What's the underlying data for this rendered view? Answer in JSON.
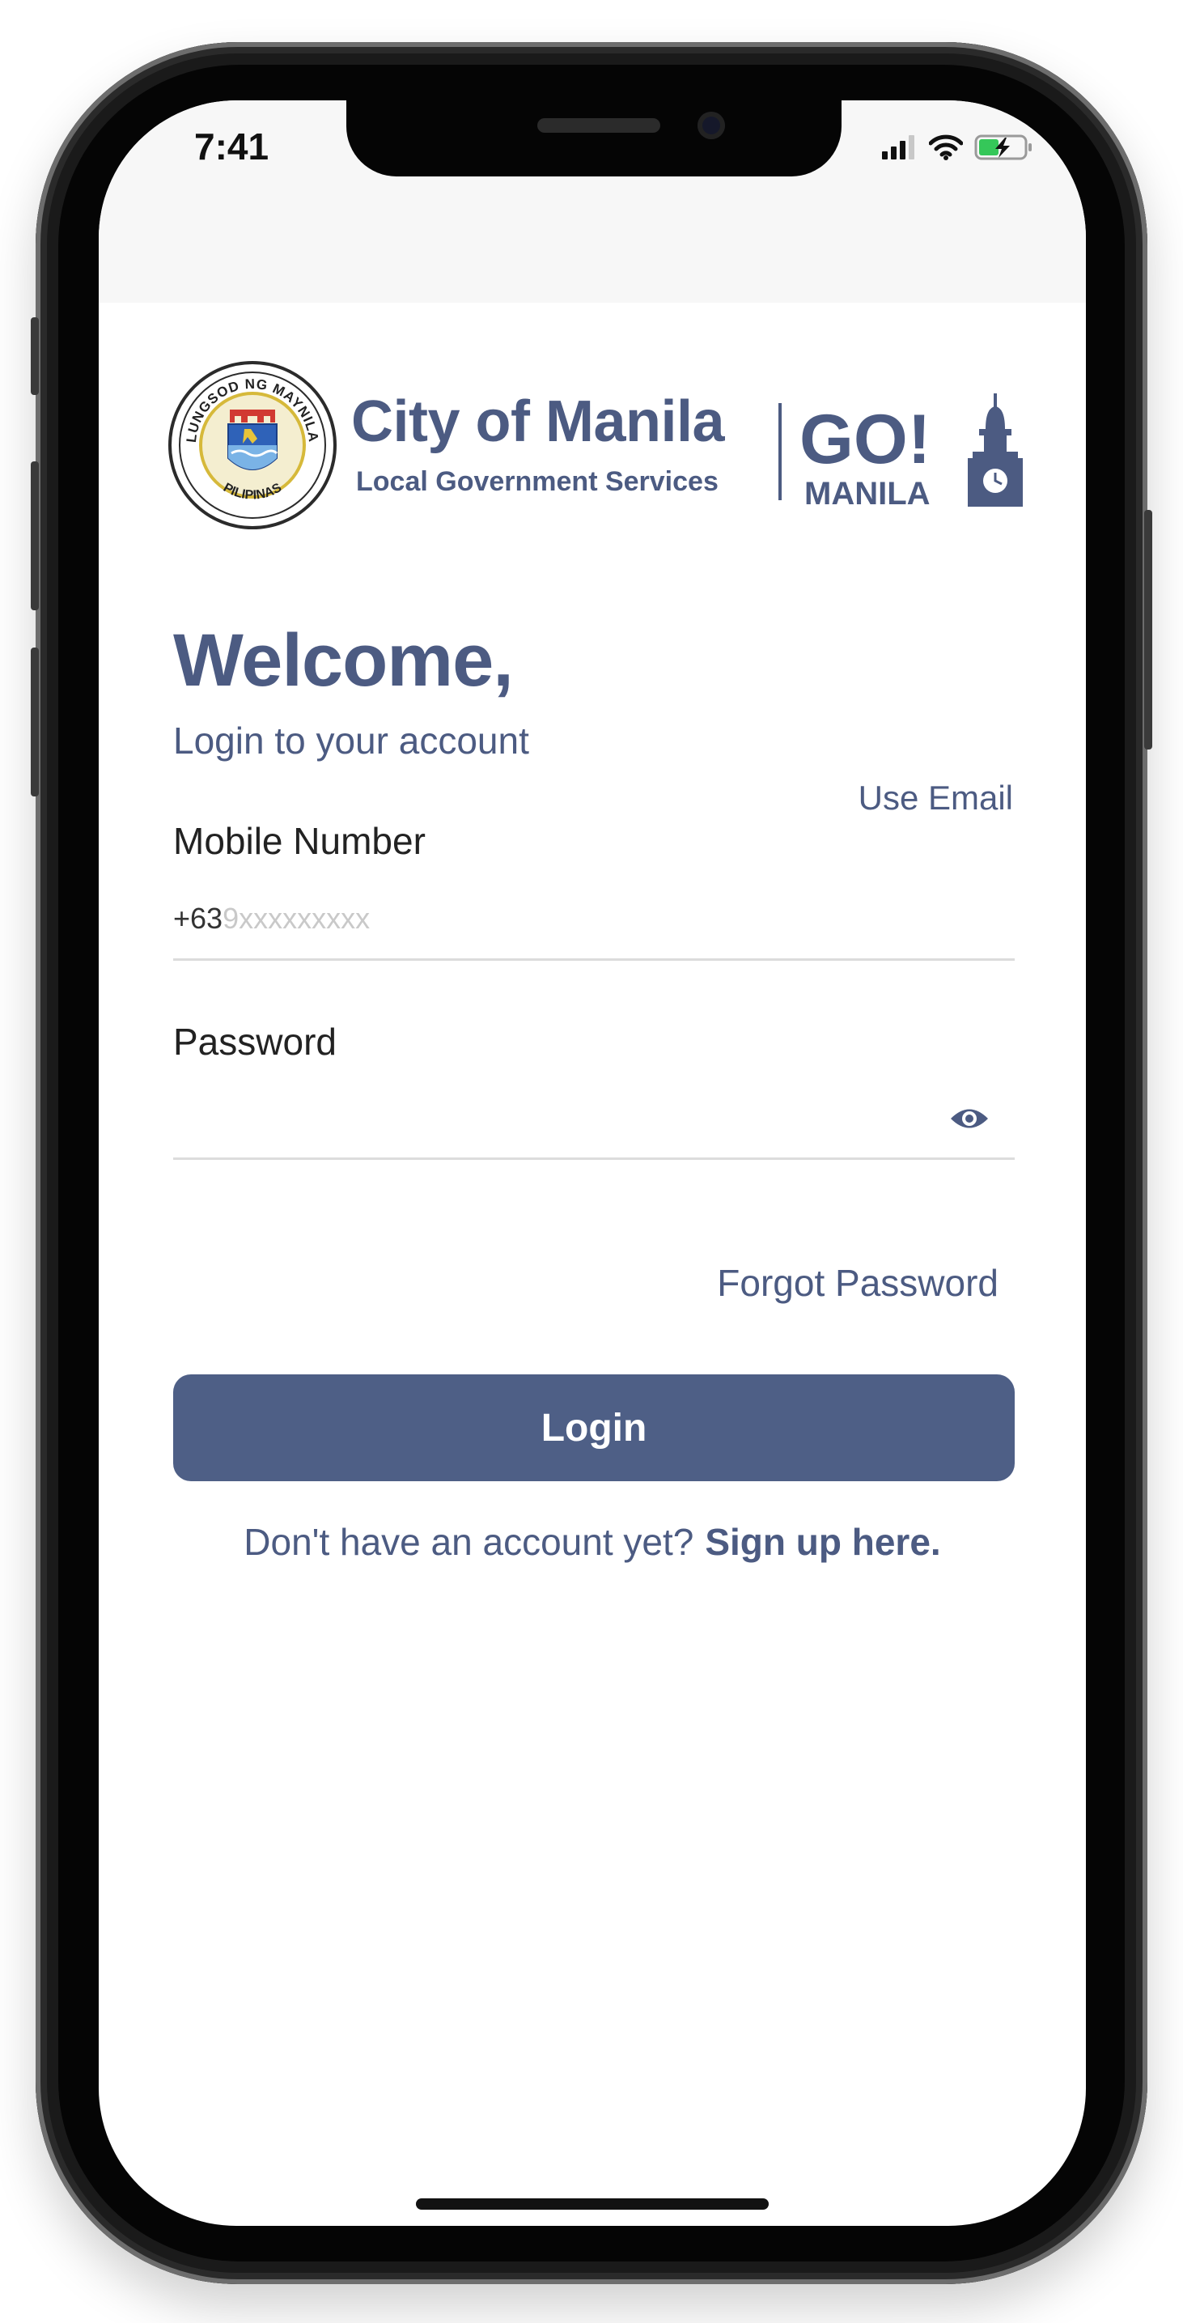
{
  "status_bar": {
    "time": "7:41"
  },
  "header": {
    "seal_text_top": "LUNGSOD NG MAYNILA",
    "seal_text_bottom": "PILIPINAS",
    "brand_title": "City of Manila",
    "brand_subtitle": "Local Government Services",
    "go_logo": "GO!",
    "go_logo_sub": "MANILA"
  },
  "form": {
    "welcome": "Welcome,",
    "subtitle": "Login to your account",
    "use_email_link": "Use Email",
    "mobile_label": "Mobile Number",
    "mobile_prefix": "+63",
    "mobile_placeholder": "9xxxxxxxxx",
    "password_label": "Password",
    "forgot_password": "Forgot Password",
    "login_button": "Login",
    "signup_prompt": "Don't have an account yet?",
    "signup_link": "Sign up here."
  },
  "colors": {
    "brand": "#4c5b82",
    "button": "#4e5f86",
    "status_bar_bg": "#f7f7f7"
  },
  "icons": [
    "signal-icon",
    "wifi-icon",
    "battery-charging-icon",
    "eye-icon",
    "city-seal-icon",
    "clock-tower-icon"
  ]
}
